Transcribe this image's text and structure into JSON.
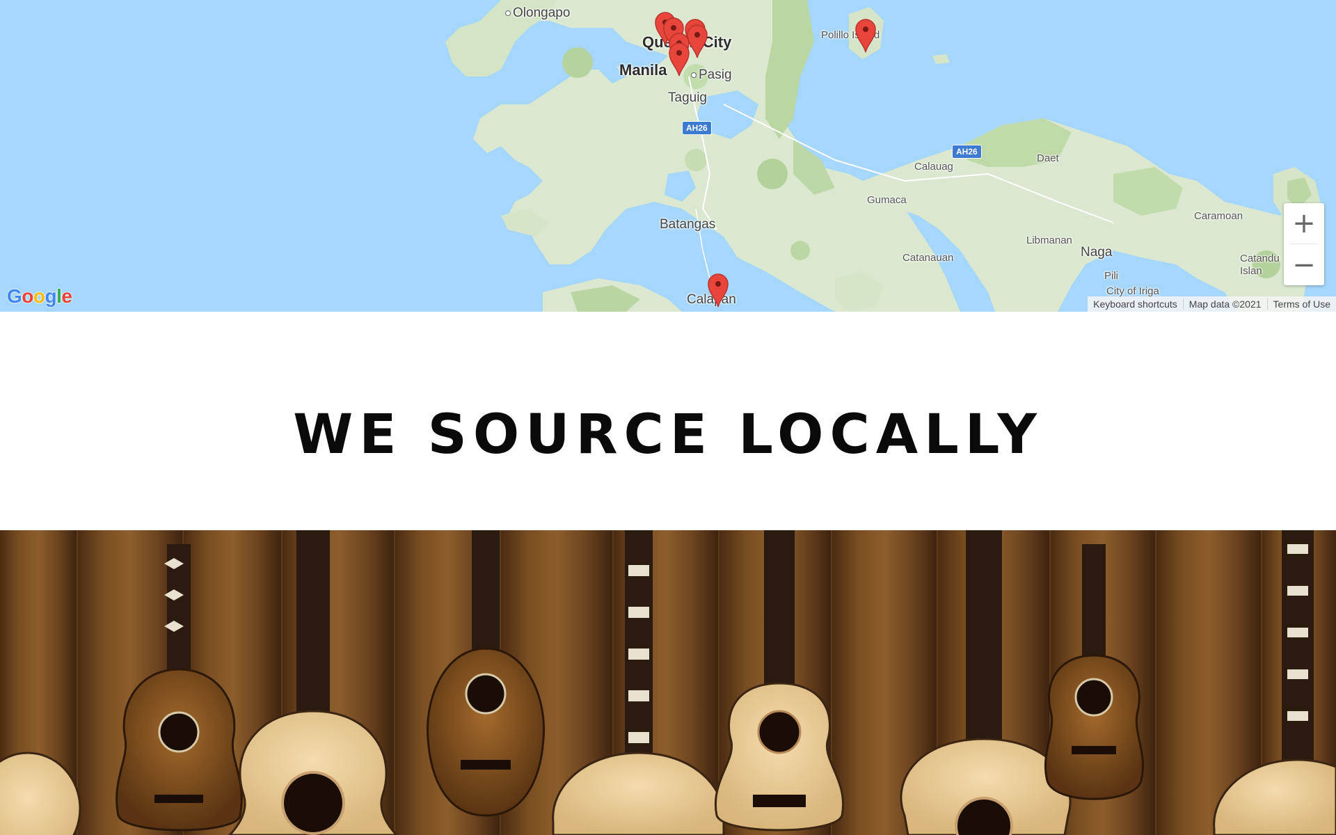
{
  "map": {
    "places": {
      "olongapo": "Olongapo",
      "quezon_city": "Quezon City",
      "manila": "Manila",
      "pasig": "Pasig",
      "taguig": "Taguig",
      "polillo_island": "Polillo Island",
      "batangas": "Batangas",
      "calapan": "Calapan",
      "gumaca": "Gumaca",
      "calauag": "Calauag",
      "daet": "Daet",
      "catanauan": "Catanauan",
      "libmanan": "Libmanan",
      "naga": "Naga",
      "pili": "Pili",
      "caramoan": "Caramoan",
      "city_of_iriga": "City of Iriga",
      "catanduanes": "Catandu Islan"
    },
    "route_shields": [
      "AH26",
      "AH26"
    ],
    "zoom_in_symbol": "+",
    "zoom_out_symbol": "−",
    "google_logo": "Google",
    "attribution": {
      "keyboard_shortcuts": "Keyboard shortcuts",
      "map_data": "Map data ©2021",
      "terms": "Terms of Use"
    },
    "marker_color": "#e8453c"
  },
  "headline": "WE SOURCE LOCALLY",
  "banner": {
    "wood_color": "#6b4420",
    "description": "wall of hanging guitars and ukuleles"
  }
}
